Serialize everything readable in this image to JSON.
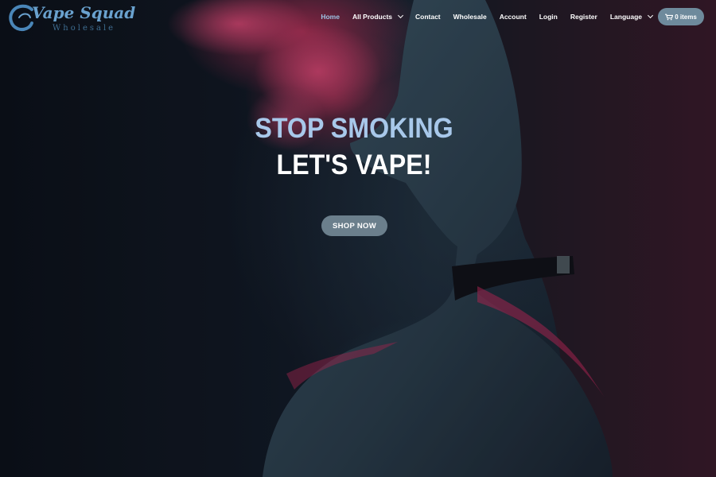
{
  "logo": {
    "title": "Vape Squad",
    "subtitle": "Wholesale"
  },
  "nav": {
    "items": [
      {
        "label": "Home",
        "active": true,
        "dropdown": false
      },
      {
        "label": "All Products",
        "active": false,
        "dropdown": true
      },
      {
        "label": "Contact",
        "active": false,
        "dropdown": false
      },
      {
        "label": "Wholesale",
        "active": false,
        "dropdown": false
      },
      {
        "label": "Account",
        "active": false,
        "dropdown": false
      },
      {
        "label": "Login",
        "active": false,
        "dropdown": false
      },
      {
        "label": "Register",
        "active": false,
        "dropdown": false
      },
      {
        "label": "Language",
        "active": false,
        "dropdown": true
      }
    ]
  },
  "cart": {
    "label": "0 items",
    "icon": "shopping-cart-icon"
  },
  "hero": {
    "headline_top": "STOP SMOKING",
    "headline_bottom": "LET'S VAPE!",
    "cta_label": "SHOP NOW"
  },
  "colors": {
    "accent": "#9dc3e4",
    "button": "#6b7f8c",
    "smoke": "#d63460",
    "background": "#0b0f17"
  }
}
